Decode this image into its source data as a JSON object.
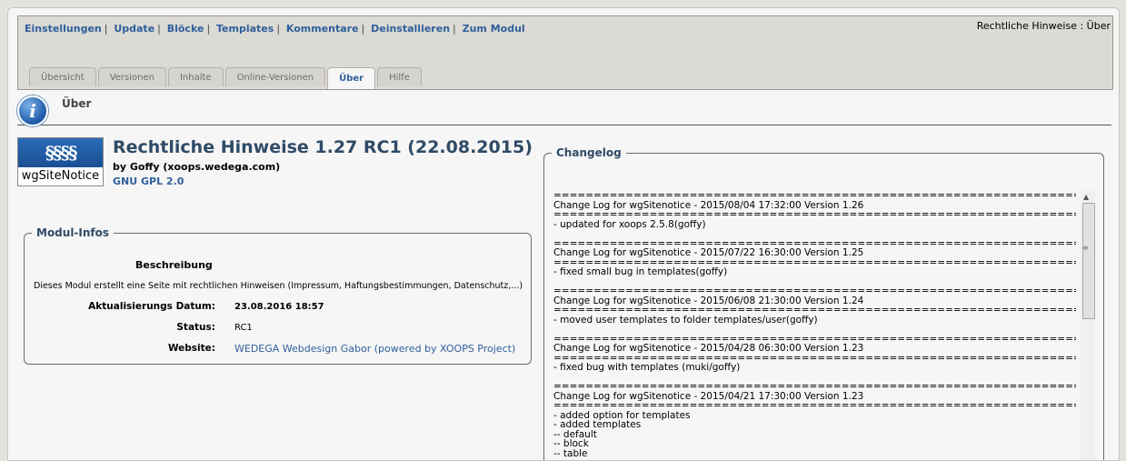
{
  "adminbar": {
    "links": [
      "Einstellungen",
      "Update",
      "Blöcke",
      "Templates",
      "Kommentare",
      "Deinstallieren",
      "Zum Modul"
    ],
    "breadcrumb": "Rechtliche Hinweise : Über"
  },
  "tabs": [
    "Übersicht",
    "Versionen",
    "Inhalte",
    "Online-Versionen",
    "Über",
    "Hilfe"
  ],
  "active_tab": "Über",
  "page": {
    "title": "Über"
  },
  "logo": {
    "symbols": "§§§§",
    "name": "wgSiteNotice"
  },
  "module": {
    "title": "Rechtliche Hinweise 1.27 RC1 (22.08.2015)",
    "author": "by Goffy (xoops.wedega.com)",
    "license": "GNU GPL 2.0"
  },
  "infos": {
    "legend": "Modul-Infos",
    "desc_heading": "Beschreibung",
    "description": "Dieses Modul erstellt eine Seite mit rechtlichen Hinweisen (Impressum, Haftungsbestimmungen, Datenschutz,...)",
    "updated_label": "Aktualisierungs Datum:",
    "updated_value": "23.08.2016 18:57",
    "status_label": "Status:",
    "status_value": "RC1",
    "website_label": "Website:",
    "website_value": "WEDEGA Webdesign Gabor (powered by XOOPS Project)"
  },
  "changelog": {
    "legend": "Changelog",
    "text": "==================================================================\nChange Log for wgSitenotice - 2015/08/04 17:32:00 Version 1.26\n==================================================================\n- updated for xoops 2.5.8(goffy)\n\n==================================================================\nChange Log for wgSitenotice - 2015/07/22 16:30:00 Version 1.25\n==================================================================\n- fixed small bug in templates(goffy)\n\n==================================================================\nChange Log for wgSitenotice - 2015/06/08 21:30:00 Version 1.24\n==================================================================\n- moved user templates to folder templates/user(goffy)\n\n==================================================================\nChange Log for wgSitenotice - 2015/04/28 06:30:00 Version 1.23\n==================================================================\n- fixed bug with templates (muki/goffy)\n\n==================================================================\nChange Log for wgSitenotice - 2015/04/21 17:30:00 Version 1.23\n==================================================================\n- added option for templates\n- added templates\n-- default\n-- block\n-- table"
  },
  "colors": {
    "link": "#2f5f9b",
    "heading": "#2f4b66",
    "bar": "#dcdad4"
  }
}
